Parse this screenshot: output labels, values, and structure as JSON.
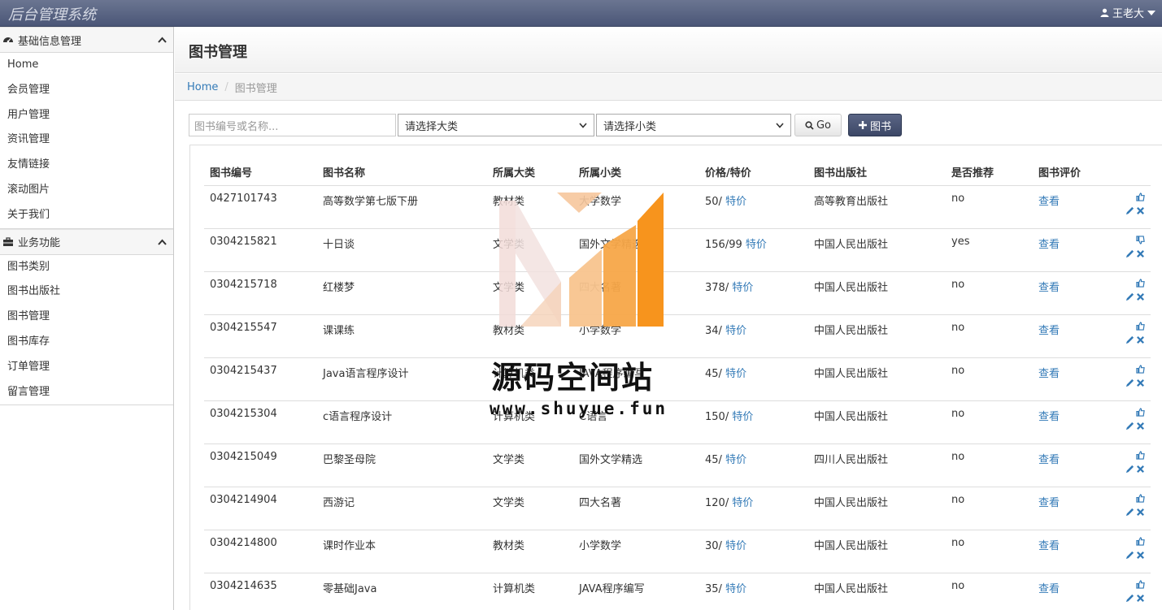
{
  "navbar": {
    "brand": "后台管理系统",
    "user": "王老大"
  },
  "sidebar": {
    "groups": [
      {
        "label": "基础信息管理",
        "items": [
          "Home",
          "会员管理",
          "用户管理",
          "资讯管理",
          "友情链接",
          "滚动图片",
          "关于我们"
        ]
      },
      {
        "label": "业务功能",
        "items": [
          "图书类别",
          "图书出版社",
          "图书管理",
          "图书库存",
          "订单管理",
          "留言管理"
        ]
      }
    ]
  },
  "page": {
    "title": "图书管理"
  },
  "breadcrumb": {
    "home": "Home",
    "current": "图书管理"
  },
  "toolbar": {
    "search_placeholder": "图书编号或名称...",
    "category_big": "请选择大类",
    "category_small": "请选择小类",
    "go_label": "Go",
    "add_label": "图书"
  },
  "table": {
    "headers": [
      "图书编号",
      "图书名称",
      "所属大类",
      "所属小类",
      "价格/特价",
      "图书出版社",
      "是否推荐",
      "图书评价"
    ],
    "special_label": "特价",
    "review_label": "查看",
    "rows": [
      {
        "id": "0427101743",
        "name": "高等数学第七版下册",
        "big": "教材类",
        "small": "大学数学",
        "price": "50/",
        "publisher": "高等教育出版社",
        "recommend": "no"
      },
      {
        "id": "0304215821",
        "name": "十日谈",
        "big": "文学类",
        "small": "国外文学精选",
        "price": "156/99",
        "publisher": "中国人民出版社",
        "recommend": "yes"
      },
      {
        "id": "0304215718",
        "name": "红楼梦",
        "big": "文学类",
        "small": "四大名著",
        "price": "378/",
        "publisher": "中国人民出版社",
        "recommend": "no"
      },
      {
        "id": "0304215547",
        "name": "课课练",
        "big": "教材类",
        "small": "小学数学",
        "price": "34/",
        "publisher": "中国人民出版社",
        "recommend": "no"
      },
      {
        "id": "0304215437",
        "name": "Java语言程序设计",
        "big": "计算机类",
        "small": "JAVA程序编写",
        "price": "45/",
        "publisher": "中国人民出版社",
        "recommend": "no"
      },
      {
        "id": "0304215304",
        "name": "c语言程序设计",
        "big": "计算机类",
        "small": "C语言",
        "price": "150/",
        "publisher": "中国人民出版社",
        "recommend": "no"
      },
      {
        "id": "0304215049",
        "name": "巴黎圣母院",
        "big": "文学类",
        "small": "国外文学精选",
        "price": "45/",
        "publisher": "四川人民出版社",
        "recommend": "no"
      },
      {
        "id": "0304214904",
        "name": "西游记",
        "big": "文学类",
        "small": "四大名著",
        "price": "120/",
        "publisher": "中国人民出版社",
        "recommend": "no"
      },
      {
        "id": "0304214800",
        "name": "课时作业本",
        "big": "教材类",
        "small": "小学数学",
        "price": "30/",
        "publisher": "中国人民出版社",
        "recommend": "no"
      },
      {
        "id": "0304214635",
        "name": "零基础Java",
        "big": "计算机类",
        "small": "JAVA程序编写",
        "price": "35/",
        "publisher": "中国人民出版社",
        "recommend": "no"
      }
    ]
  },
  "watermark": {
    "text": "源码空间站",
    "url": "www.shuyue.fun"
  },
  "colors": {
    "navbar": "#4b5677",
    "link": "#337ab7",
    "add_button": "#3c4766",
    "watermark_orange": "#f7941d"
  }
}
